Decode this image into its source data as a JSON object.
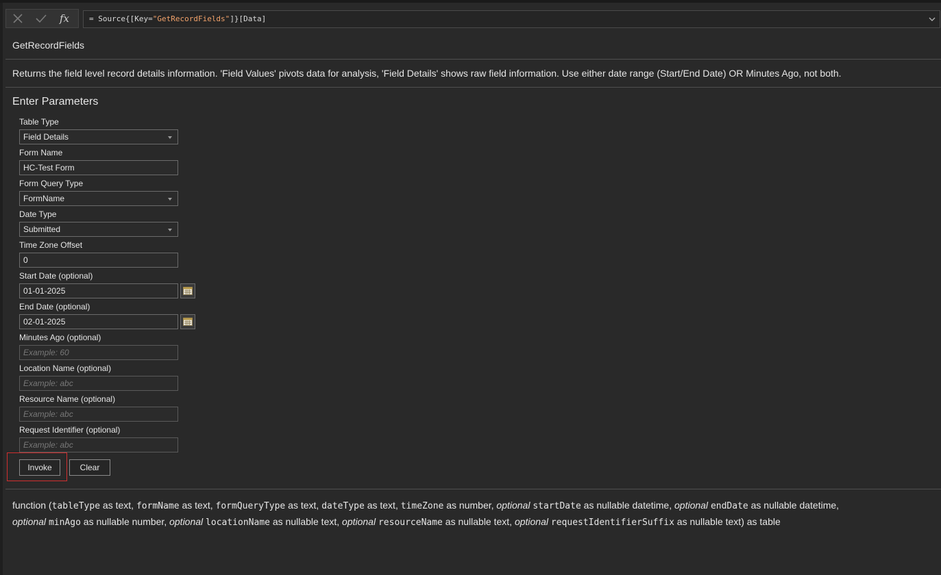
{
  "formula_bar": {
    "cancel_icon": "x-icon",
    "confirm_icon": "check-icon",
    "fx_label": "fx",
    "formula_prefix": "= Source{[Key=",
    "formula_string": "\"GetRecordFields\"",
    "formula_suffix": "]}[Data]",
    "expand_icon": "chevron-down-icon"
  },
  "function": {
    "name": "GetRecordFields",
    "description": "Returns the field level record details information. 'Field Values' pivots data for analysis, 'Field Details' shows raw field information. Use either date range (Start/End Date) OR Minutes Ago, not both."
  },
  "parameters_section": {
    "heading": "Enter Parameters",
    "fields": [
      {
        "label": "Table Type",
        "value": "Field Details",
        "kind": "dropdown"
      },
      {
        "label": "Form Name",
        "value": "HC-Test Form",
        "kind": "text"
      },
      {
        "label": "Form Query Type",
        "value": "FormName",
        "kind": "dropdown"
      },
      {
        "label": "Date Type",
        "value": "Submitted",
        "kind": "dropdown"
      },
      {
        "label": "Time Zone Offset",
        "value": "0",
        "kind": "text"
      },
      {
        "label": "Start Date (optional)",
        "value": "01-01-2025",
        "kind": "date"
      },
      {
        "label": "End Date (optional)",
        "value": "02-01-2025",
        "kind": "date"
      },
      {
        "label": "Minutes Ago (optional)",
        "placeholder": "Example: 60",
        "kind": "text"
      },
      {
        "label": "Location Name (optional)",
        "placeholder": "Example: abc",
        "kind": "text"
      },
      {
        "label": "Resource Name (optional)",
        "placeholder": "Example: abc",
        "kind": "text"
      },
      {
        "label": "Request Identifier (optional)",
        "placeholder": "Example: abc",
        "kind": "text"
      }
    ],
    "invoke_label": "Invoke",
    "clear_label": "Clear",
    "highlight_color": "#d12f2f"
  },
  "signature": {
    "p1": "function (",
    "a1": "tableType",
    "t1": " as text, ",
    "a2": "formName",
    "t2": " as text, ",
    "a3": "formQueryType",
    "t3": " as text, ",
    "a4": "dateType",
    "t4": " as text, ",
    "a5": "timeZone",
    "t5": " as number, ",
    "opt": "optional",
    "a6": "startDate",
    "t6": " as nullable datetime, ",
    "a7": "endDate",
    "t7": " as nullable datetime,",
    "a8": "minAgo",
    "t8": " as nullable number, ",
    "a9": "locationName",
    "t9": " as nullable text, ",
    "a10": "resourceName",
    "t10": " as nullable text, ",
    "a11": "requestIdentifierSuffix",
    "t11": " as nullable text) as table"
  }
}
